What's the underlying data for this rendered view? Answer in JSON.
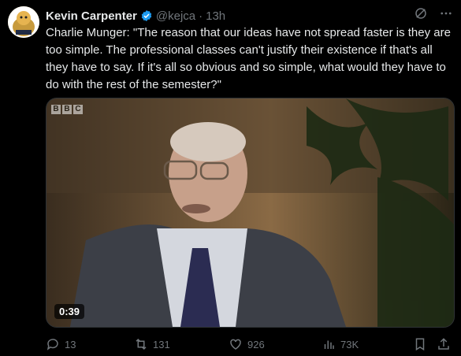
{
  "author": {
    "name": "Kevin Carpenter",
    "handle": "@kejca",
    "time": "13h",
    "dot": "·"
  },
  "tweet": {
    "text": "Charlie Munger: \"The reason that our ideas have not spread faster is they are too simple. The professional classes can't justify their existence if that's all they have to say. If it's all so obvious and so simple, what would they have to do with the rest of the semester?\""
  },
  "media": {
    "watermark_letters": [
      "B",
      "B",
      "C"
    ],
    "duration": "0:39"
  },
  "actions": {
    "replies": "13",
    "reposts": "131",
    "likes": "926",
    "views": "73K"
  },
  "colors": {
    "verified": "#1d9bf0",
    "muted": "#71767b",
    "text": "#e7e9ea"
  }
}
